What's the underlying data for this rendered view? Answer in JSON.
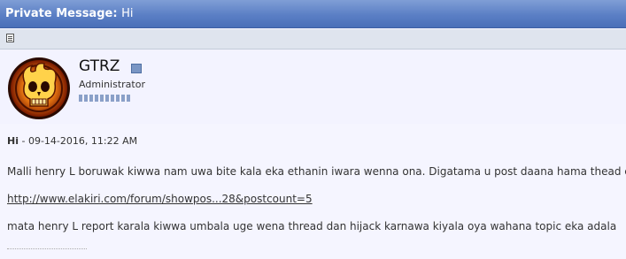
{
  "titlebar": {
    "prefix": "Private Message:",
    "subject": "Hi"
  },
  "toolbar": {
    "icon": "post-icon"
  },
  "user": {
    "name": "GTRZ",
    "title": "Administrator",
    "status_icon": "offline-status-icon",
    "avatar_icon": "flaming-skull-avatar",
    "reputation_pips": 10
  },
  "post": {
    "title": "Hi",
    "separator": " - ",
    "date": "09-14-2016, 11:22 AM",
    "line1": "Malli henry L boruwak kiwwa nam uwa bite kala eka ethanin iwara wenna ona. Digatama u post daana hama thead eka",
    "link": "http://www.elakiri.com/forum/showpos...28&postcount=5",
    "line3": "mata henry L report karala kiwwa umbala uge wena thread dan hijack karnawa kiyala oya wahana topic eka adala"
  },
  "colors": {
    "titlebar": "#5b7fc5",
    "background": "#f5f5ff",
    "toolbar": "#dfe4ee"
  }
}
